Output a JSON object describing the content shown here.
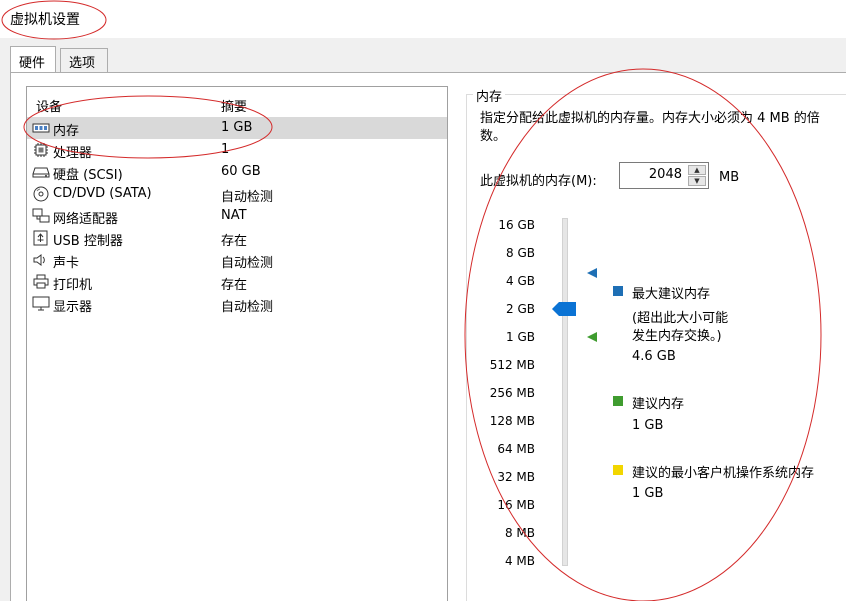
{
  "window": {
    "title": "虚拟机设置"
  },
  "tabs": [
    {
      "label": "硬件"
    },
    {
      "label": "选项"
    }
  ],
  "device_list": {
    "headers": {
      "device": "设备",
      "summary": "摘要"
    },
    "rows": [
      {
        "name": "内存",
        "summary": "1 GB",
        "icon": "memory-icon",
        "selected": true
      },
      {
        "name": "处理器",
        "summary": "1",
        "icon": "processor-icon"
      },
      {
        "name": "硬盘 (SCSI)",
        "summary": "60 GB",
        "icon": "hard-disk-icon"
      },
      {
        "name": "CD/DVD (SATA)",
        "summary": "自动检测",
        "icon": "cd-dvd-icon"
      },
      {
        "name": "网络适配器",
        "summary": "NAT",
        "icon": "network-adapter-icon"
      },
      {
        "name": "USB 控制器",
        "summary": "存在",
        "icon": "usb-icon"
      },
      {
        "name": "声卡",
        "summary": "自动检测",
        "icon": "speaker-icon"
      },
      {
        "name": "打印机",
        "summary": "存在",
        "icon": "printer-icon"
      },
      {
        "name": "显示器",
        "summary": "自动检测",
        "icon": "monitor-icon"
      }
    ]
  },
  "memory": {
    "group_title": "内存",
    "description": "指定分配给此虚拟机的内存量。内存大小必须为 4 MB 的倍数。",
    "label": "此虚拟机的内存(M):",
    "value": "2048",
    "unit": "MB",
    "scale": [
      "16 GB",
      "8 GB",
      "4 GB",
      "2 GB",
      "1 GB",
      "512 MB",
      "256 MB",
      "128 MB",
      "64 MB",
      "32 MB",
      "16 MB",
      "8 MB",
      "4 MB"
    ],
    "legend": {
      "max": {
        "title": "最大建议内存",
        "note_1": "(超出此大小可能",
        "note_2": "发生内存交换。)",
        "value": "4.6 GB",
        "color": "#1e6fb5"
      },
      "recommended": {
        "title": "建议内存",
        "value": "1 GB",
        "color": "#3f9c2f"
      },
      "guest_min": {
        "title": "建议的最小客户机操作系统内存",
        "value": "1 GB",
        "color": "#f2d600"
      }
    },
    "slider_color": "#0b73d4"
  }
}
